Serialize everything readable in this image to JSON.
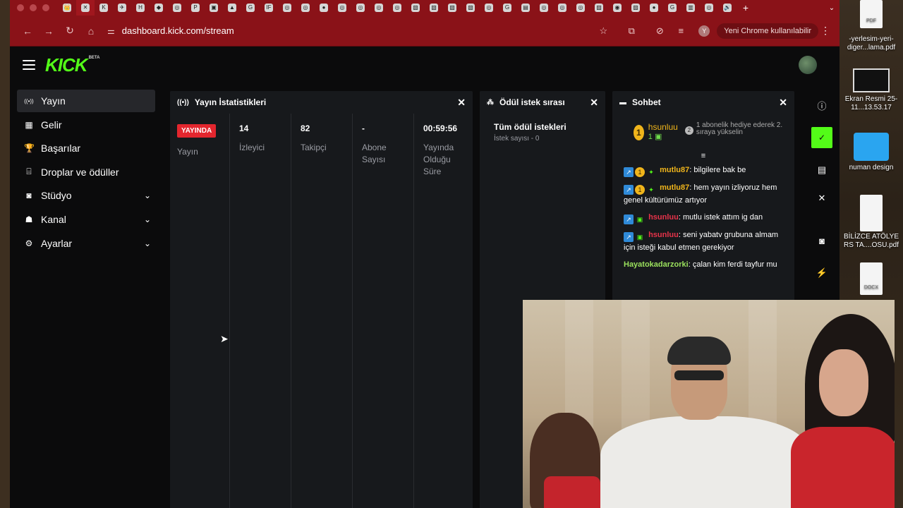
{
  "browser": {
    "url": "dashboard.kick.com/stream",
    "update_label": "Yeni Chrome kullanılabilir",
    "profile_initial": "Y",
    "tabs": [
      "👑",
      "✕",
      "K",
      "✈",
      "H",
      "◆",
      "◎",
      "P",
      "▣",
      "▲",
      "G",
      "IF",
      "◎",
      "◎",
      "●",
      "◎",
      "◎",
      "◎",
      "◎",
      "▧",
      "▧",
      "▧",
      "▧",
      "◎",
      "G",
      "▤",
      "◎",
      "◎",
      "◎",
      "▨",
      "◉",
      "▨",
      "●",
      "G",
      "▥",
      "◎",
      "🔊"
    ],
    "active_tab_index": 1,
    "new_tab": "+",
    "tab_menu": "⌄"
  },
  "app": {
    "logo": "KICK",
    "beta": "BETA"
  },
  "sidebar": {
    "items": [
      {
        "label": "Yayın",
        "icon": "((•))"
      },
      {
        "label": "Gelir",
        "icon": "▦"
      },
      {
        "label": "Başarılar",
        "icon": "🏆"
      },
      {
        "label": "Droplar ve ödüller",
        "icon": "⌸"
      },
      {
        "label": "Stüdyo",
        "icon": "◙"
      },
      {
        "label": "Kanal",
        "icon": "☗"
      },
      {
        "label": "Ayarlar",
        "icon": "⚙"
      }
    ]
  },
  "stats_panel": {
    "title": "Yayın İstatistikleri",
    "live_badge": "YAYINDA",
    "stream_label": "Yayın",
    "viewers_value": "14",
    "viewers_label": "İzleyici",
    "followers_value": "82",
    "followers_label": "Takipçi",
    "subs_value": "-",
    "subs_label": "Abone Sayısı",
    "uptime_value": "00:59:56",
    "uptime_label": "Yayında Olduğu Süre"
  },
  "rewards_panel": {
    "title": "Ödül istek sırası",
    "all_requests": "Tüm ödül istekleri",
    "request_count": "İstek sayısı - 0"
  },
  "chat_panel": {
    "title": "Sohbet",
    "gift_user": "hsunluu",
    "gift_rank": "1",
    "gift_count": "1",
    "gift_next_rank": "2",
    "gift_text": "1 abonelik hediye ederek 2. sıraya yükselin",
    "messages": [
      {
        "user": "mutlu87",
        "text": "bilgilere bak be"
      },
      {
        "user": "mutlu87",
        "text": "hem yayın izliyoruz hem genel kültürümüz artıyor"
      },
      {
        "user": "hsunluu",
        "text": "mutlu istek attım ig dan"
      },
      {
        "user": "hsunluu",
        "text": "seni yabatv grubuna almam için isteği kabul etmen gerekiyor"
      },
      {
        "user": "Hayatokadarzorki",
        "text": "çalan kim ferdi tayfur mu"
      }
    ]
  },
  "desktop": {
    "items": [
      {
        "label": "-yerlesim-yeri-diger...lama.pdf",
        "tag": "PDF"
      },
      {
        "label": "Ekran Resmi 25-11...13.53.17"
      },
      {
        "label": "numan design"
      },
      {
        "label": "BİLİZCE ATÖLYE RS TA....OSU.pdf"
      },
      {
        "label": "",
        "tag": "DOCX"
      }
    ]
  }
}
